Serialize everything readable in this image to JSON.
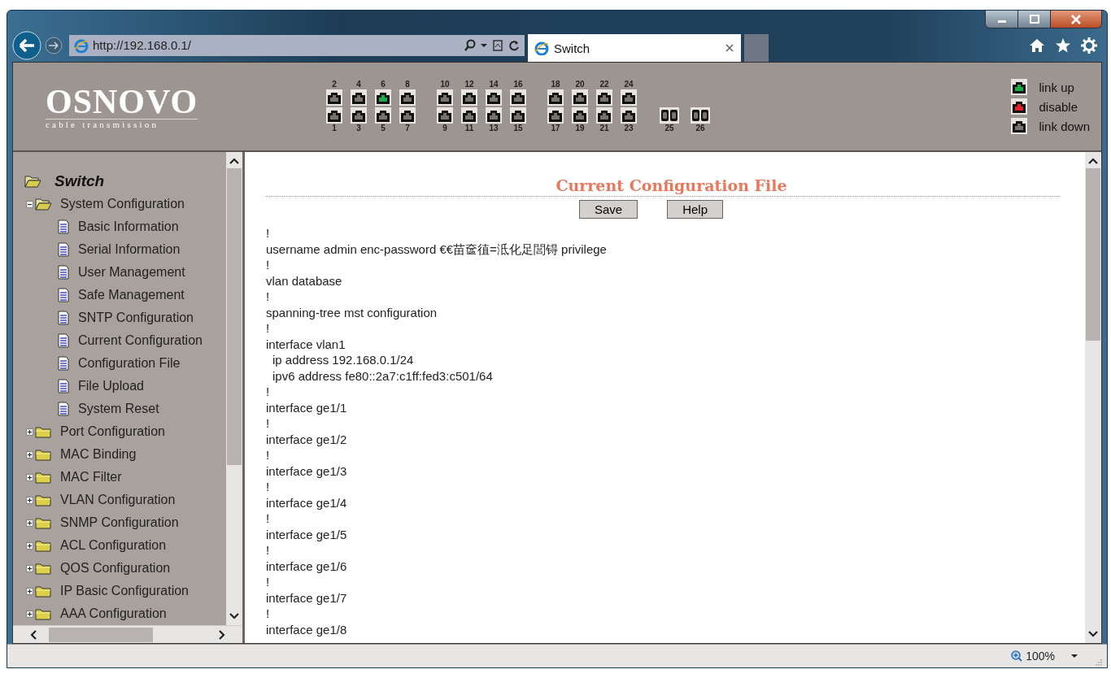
{
  "browser": {
    "address": "http://192.168.0.1/",
    "tabs": [
      {
        "title": "Switch",
        "selected": true
      }
    ],
    "zoom": "100%"
  },
  "header": {
    "logo": "OSNOVO",
    "tagline": "cable transmission",
    "ports_top": [
      {
        "label": "2",
        "link_up": false
      },
      {
        "label": "4",
        "link_up": false
      },
      {
        "label": "6",
        "link_up": true
      },
      {
        "label": "8",
        "link_up": false
      },
      {
        "label": "10",
        "link_up": false
      },
      {
        "label": "12",
        "link_up": false
      },
      {
        "label": "14",
        "link_up": false
      },
      {
        "label": "16",
        "link_up": false
      },
      {
        "label": "18",
        "link_up": false
      },
      {
        "label": "20",
        "link_up": false
      },
      {
        "label": "22",
        "link_up": false
      },
      {
        "label": "24",
        "link_up": false
      }
    ],
    "ports_bottom": [
      {
        "label": "1",
        "link_up": false,
        "kind": "copper"
      },
      {
        "label": "3",
        "link_up": false,
        "kind": "copper"
      },
      {
        "label": "5",
        "link_up": false,
        "kind": "copper"
      },
      {
        "label": "7",
        "link_up": false,
        "kind": "copper"
      },
      {
        "label": "9",
        "link_up": false,
        "kind": "copper"
      },
      {
        "label": "11",
        "link_up": false,
        "kind": "copper"
      },
      {
        "label": "13",
        "link_up": false,
        "kind": "copper"
      },
      {
        "label": "15",
        "link_up": false,
        "kind": "copper"
      },
      {
        "label": "17",
        "link_up": false,
        "kind": "copper"
      },
      {
        "label": "19",
        "link_up": false,
        "kind": "copper"
      },
      {
        "label": "21",
        "link_up": false,
        "kind": "copper"
      },
      {
        "label": "23",
        "link_up": false,
        "kind": "copper"
      },
      {
        "label": "25",
        "link_up": false,
        "kind": "fiber"
      },
      {
        "label": "26",
        "link_up": false,
        "kind": "fiber"
      }
    ],
    "legend": [
      {
        "label": "link up",
        "color": "#1ea84a"
      },
      {
        "label": "disable",
        "color": "#e0202a"
      },
      {
        "label": "link down",
        "color": "#7a726e"
      }
    ]
  },
  "sidebar": {
    "tree": {
      "label": "Switch",
      "expanded": true,
      "children": [
        {
          "label": "System Configuration",
          "expanded": true,
          "children": [
            {
              "label": "Basic Information"
            },
            {
              "label": "Serial Information"
            },
            {
              "label": "User Management"
            },
            {
              "label": "Safe Management"
            },
            {
              "label": "SNTP Configuration"
            },
            {
              "label": "Current Configuration"
            },
            {
              "label": "Configuration File"
            },
            {
              "label": "File Upload"
            },
            {
              "label": "System Reset"
            }
          ]
        },
        {
          "label": "Port Configuration",
          "expanded": false
        },
        {
          "label": "MAC Binding",
          "expanded": false
        },
        {
          "label": "MAC Filter",
          "expanded": false
        },
        {
          "label": "VLAN Configuration",
          "expanded": false
        },
        {
          "label": "SNMP Configuration",
          "expanded": false
        },
        {
          "label": "ACL Configuration",
          "expanded": false
        },
        {
          "label": "QOS Configuration",
          "expanded": false
        },
        {
          "label": "IP Basic Configuration",
          "expanded": false
        },
        {
          "label": "AAA Configuration",
          "expanded": false
        }
      ]
    }
  },
  "content": {
    "title": "Current Configuration File",
    "buttons": [
      "Save",
      "Help"
    ],
    "lines": [
      {
        "text": "!",
        "indent": false
      },
      {
        "text": "username admin enc-password €€苗奩徝=泜化足閭锝 privilege",
        "indent": false
      },
      {
        "text": "!",
        "indent": false
      },
      {
        "text": "vlan database",
        "indent": false
      },
      {
        "text": "!",
        "indent": false
      },
      {
        "text": "spanning-tree mst configuration",
        "indent": false
      },
      {
        "text": "!",
        "indent": false
      },
      {
        "text": "interface vlan1",
        "indent": false
      },
      {
        "text": "ip address 192.168.0.1/24",
        "indent": true
      },
      {
        "text": "ipv6 address fe80::2a7:c1ff:fed3:c501/64",
        "indent": true
      },
      {
        "text": "!",
        "indent": false
      },
      {
        "text": "interface ge1/1",
        "indent": false
      },
      {
        "text": "!",
        "indent": false
      },
      {
        "text": "interface ge1/2",
        "indent": false
      },
      {
        "text": "!",
        "indent": false
      },
      {
        "text": "interface ge1/3",
        "indent": false
      },
      {
        "text": "!",
        "indent": false
      },
      {
        "text": "interface ge1/4",
        "indent": false
      },
      {
        "text": "!",
        "indent": false
      },
      {
        "text": "interface ge1/5",
        "indent": false
      },
      {
        "text": "!",
        "indent": false
      },
      {
        "text": "interface ge1/6",
        "indent": false
      },
      {
        "text": "!",
        "indent": false
      },
      {
        "text": "interface ge1/7",
        "indent": false
      },
      {
        "text": "!",
        "indent": false
      },
      {
        "text": "interface ge1/8",
        "indent": false
      }
    ]
  }
}
